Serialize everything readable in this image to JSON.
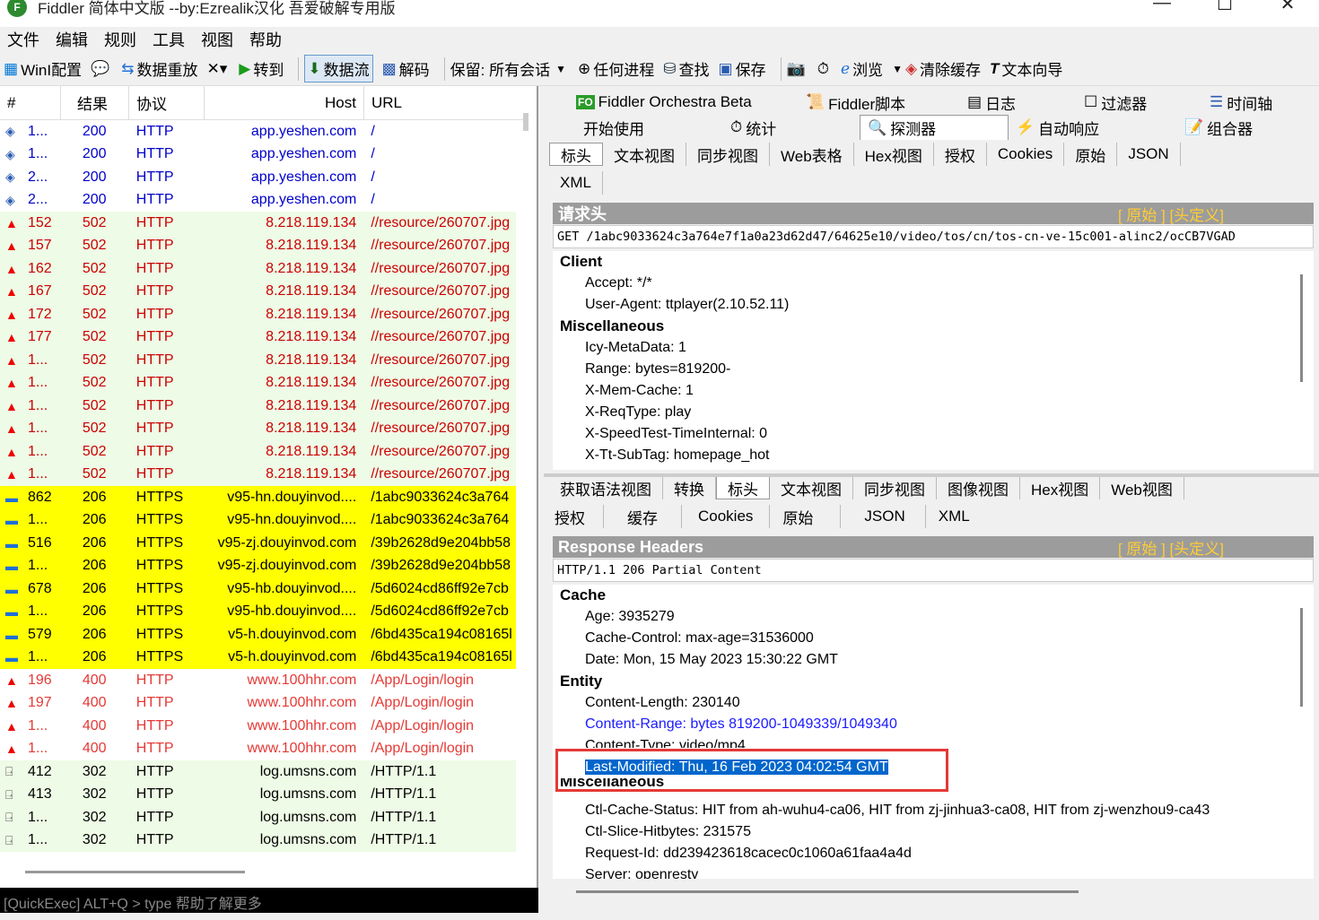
{
  "window": {
    "title": "Fiddler 简体中文版 --by:Ezrealik汉化 吾爱破解专用版",
    "icon": "F"
  },
  "menu": [
    "文件",
    "编辑",
    "规则",
    "工具",
    "视图",
    "帮助"
  ],
  "toolbar": {
    "winconfig": "WinI配置",
    "replay": "数据重放",
    "goto": "转到",
    "stream": "数据流",
    "decode": "解码",
    "keep": "保留: 所有会话",
    "anyprocess": "任何进程",
    "find": "查找",
    "save": "保存",
    "browse": "浏览",
    "clearcache": "清除缓存",
    "textwizard": "文本向导"
  },
  "grid": {
    "headers": {
      "num": "#",
      "result": "结果",
      "protocol": "协议",
      "host": "Host",
      "url": "URL"
    },
    "rows": [
      {
        "num": "1...",
        "result": "200",
        "protocol": "HTTP",
        "host": "app.yeshen.com",
        "url": "/",
        "kind": "web"
      },
      {
        "num": "1...",
        "result": "200",
        "protocol": "HTTP",
        "host": "app.yeshen.com",
        "url": "/",
        "kind": "web"
      },
      {
        "num": "2...",
        "result": "200",
        "protocol": "HTTP",
        "host": "app.yeshen.com",
        "url": "/",
        "kind": "web"
      },
      {
        "num": "2...",
        "result": "200",
        "protocol": "HTTP",
        "host": "app.yeshen.com",
        "url": "/",
        "kind": "web"
      },
      {
        "num": "152",
        "result": "502",
        "protocol": "HTTP",
        "host": "8.218.119.134",
        "url": "//resource/260707.jpg",
        "kind": "err502"
      },
      {
        "num": "157",
        "result": "502",
        "protocol": "HTTP",
        "host": "8.218.119.134",
        "url": "//resource/260707.jpg",
        "kind": "err502"
      },
      {
        "num": "162",
        "result": "502",
        "protocol": "HTTP",
        "host": "8.218.119.134",
        "url": "//resource/260707.jpg",
        "kind": "err502"
      },
      {
        "num": "167",
        "result": "502",
        "protocol": "HTTP",
        "host": "8.218.119.134",
        "url": "//resource/260707.jpg",
        "kind": "err502"
      },
      {
        "num": "172",
        "result": "502",
        "protocol": "HTTP",
        "host": "8.218.119.134",
        "url": "//resource/260707.jpg",
        "kind": "err502"
      },
      {
        "num": "177",
        "result": "502",
        "protocol": "HTTP",
        "host": "8.218.119.134",
        "url": "//resource/260707.jpg",
        "kind": "err502"
      },
      {
        "num": "1...",
        "result": "502",
        "protocol": "HTTP",
        "host": "8.218.119.134",
        "url": "//resource/260707.jpg",
        "kind": "err502"
      },
      {
        "num": "1...",
        "result": "502",
        "protocol": "HTTP",
        "host": "8.218.119.134",
        "url": "//resource/260707.jpg",
        "kind": "err502"
      },
      {
        "num": "1...",
        "result": "502",
        "protocol": "HTTP",
        "host": "8.218.119.134",
        "url": "//resource/260707.jpg",
        "kind": "err502"
      },
      {
        "num": "1...",
        "result": "502",
        "protocol": "HTTP",
        "host": "8.218.119.134",
        "url": "//resource/260707.jpg",
        "kind": "err502"
      },
      {
        "num": "1...",
        "result": "502",
        "protocol": "HTTP",
        "host": "8.218.119.134",
        "url": "//resource/260707.jpg",
        "kind": "err502"
      },
      {
        "num": "1...",
        "result": "502",
        "protocol": "HTTP",
        "host": "8.218.119.134",
        "url": "//resource/260707.jpg",
        "kind": "err502"
      },
      {
        "num": "862",
        "result": "206",
        "protocol": "HTTPS",
        "host": "v95-hn.douyinvod....",
        "url": "/1abc9033624c3a764",
        "kind": "video"
      },
      {
        "num": "1...",
        "result": "206",
        "protocol": "HTTPS",
        "host": "v95-hn.douyinvod....",
        "url": "/1abc9033624c3a764",
        "kind": "video"
      },
      {
        "num": "516",
        "result": "206",
        "protocol": "HTTPS",
        "host": "v95-zj.douyinvod.com",
        "url": "/39b2628d9e204bb58",
        "kind": "video"
      },
      {
        "num": "1...",
        "result": "206",
        "protocol": "HTTPS",
        "host": "v95-zj.douyinvod.com",
        "url": "/39b2628d9e204bb58",
        "kind": "video"
      },
      {
        "num": "678",
        "result": "206",
        "protocol": "HTTPS",
        "host": "v95-hb.douyinvod....",
        "url": "/5d6024cd86ff92e7cb",
        "kind": "video"
      },
      {
        "num": "1...",
        "result": "206",
        "protocol": "HTTPS",
        "host": "v95-hb.douyinvod....",
        "url": "/5d6024cd86ff92e7cb",
        "kind": "video"
      },
      {
        "num": "579",
        "result": "206",
        "protocol": "HTTPS",
        "host": "v5-h.douyinvod.com",
        "url": "/6bd435ca194c08165l",
        "kind": "video"
      },
      {
        "num": "1...",
        "result": "206",
        "protocol": "HTTPS",
        "host": "v5-h.douyinvod.com",
        "url": "/6bd435ca194c08165l",
        "kind": "video"
      },
      {
        "num": "196",
        "result": "400",
        "protocol": "HTTP",
        "host": "www.100hhr.com",
        "url": "/App/Login/login",
        "kind": "err400"
      },
      {
        "num": "197",
        "result": "400",
        "protocol": "HTTP",
        "host": "www.100hhr.com",
        "url": "/App/Login/login",
        "kind": "err400"
      },
      {
        "num": "1...",
        "result": "400",
        "protocol": "HTTP",
        "host": "www.100hhr.com",
        "url": "/App/Login/login",
        "kind": "err400"
      },
      {
        "num": "1...",
        "result": "400",
        "protocol": "HTTP",
        "host": "www.100hhr.com",
        "url": "/App/Login/login",
        "kind": "err400"
      },
      {
        "num": "412",
        "result": "302",
        "protocol": "HTTP",
        "host": "log.umsns.com",
        "url": "/HTTP/1.1",
        "kind": "redirect"
      },
      {
        "num": "413",
        "result": "302",
        "protocol": "HTTP",
        "host": "log.umsns.com",
        "url": "/HTTP/1.1",
        "kind": "redirect"
      },
      {
        "num": "1...",
        "result": "302",
        "protocol": "HTTP",
        "host": "log.umsns.com",
        "url": "/HTTP/1.1",
        "kind": "redirect"
      },
      {
        "num": "1...",
        "result": "302",
        "protocol": "HTTP",
        "host": "log.umsns.com",
        "url": "/HTTP/1.1",
        "kind": "redirect"
      }
    ]
  },
  "quickexec": "[QuickExec] ALT+Q > type 帮助了解更多",
  "toptabs": {
    "row1": [
      "Fiddler Orchestra Beta",
      "Fiddler脚本",
      "日志",
      "过滤器",
      "时间轴"
    ],
    "row2": [
      "开始使用",
      "统计",
      "探测器",
      "自动响应",
      "组合器"
    ],
    "fo_badge": "FO"
  },
  "request": {
    "tabs1": [
      "标头",
      "文本视图",
      "同步视图",
      "Web表格",
      "Hex视图",
      "授权",
      "Cookies",
      "原始",
      "JSON"
    ],
    "tabs2": [
      "XML"
    ],
    "section_title": "请求头",
    "links": "[ 原始 ]  [头定义]",
    "line": "GET /1abc9033624c3a764e7f1a0a23d62d47/64625e10/video/tos/cn/tos-cn-ve-15c001-alinc2/ocCB7VGAD",
    "groups": [
      {
        "name": "Client",
        "items": [
          "Accept: */*",
          "User-Agent: ttplayer(2.10.52.11)"
        ]
      },
      {
        "name": "Miscellaneous",
        "items": [
          "Icy-MetaData: 1",
          "Range: bytes=819200-",
          "X-Mem-Cache: 1",
          "X-ReqType: play",
          "X-SpeedTest-TimeInternal: 0",
          "X-Tt-SubTag: homepage_hot"
        ]
      }
    ]
  },
  "response": {
    "tabs1": [
      "获取语法视图",
      "转换",
      "标头",
      "文本视图",
      "同步视图",
      "图像视图",
      "Hex视图",
      "Web视图"
    ],
    "tabs2": [
      "授权",
      "缓存",
      "Cookies",
      "原始",
      "JSON",
      "XML"
    ],
    "section_title": "Response Headers",
    "links": "[ 原始 ]  [头定义]",
    "line": "HTTP/1.1 206 Partial Content",
    "cache": {
      "name": "Cache",
      "items": [
        "Age: 3935279",
        "Cache-Control: max-age=31536000",
        "Date: Mon, 15 May 2023 15:30:22 GMT"
      ]
    },
    "entity": {
      "name": "Entity",
      "items": [
        "Content-Length: 230140"
      ],
      "range": "Content-Range: bytes 819200-1049339/1049340",
      "type": "Content-Type: video/mp4",
      "modified": "Last-Modified: Thu, 16 Feb 2023 04:02:54 GMT"
    },
    "misc": {
      "name": "Miscellaneous",
      "items": [
        "Ctl-Cache-Status: HIT from ah-wuhu4-ca06, HIT from zj-jinhua3-ca08, HIT from zj-wenzhou9-ca43",
        "Ctl-Slice-Hitbytes: 231575",
        "Request-Id: dd239423618cacec0c1060a61faa4a4d",
        "Server: openresty"
      ]
    }
  },
  "colors": {
    "err502_bg": "#eefbe6",
    "video_bg": "#ffff00",
    "err400_text": "#e53935",
    "redirect_bg": "#eefbe6",
    "web_text": "#0000cc",
    "err_text": "#cc0000",
    "highlight_box": "#e53935"
  }
}
